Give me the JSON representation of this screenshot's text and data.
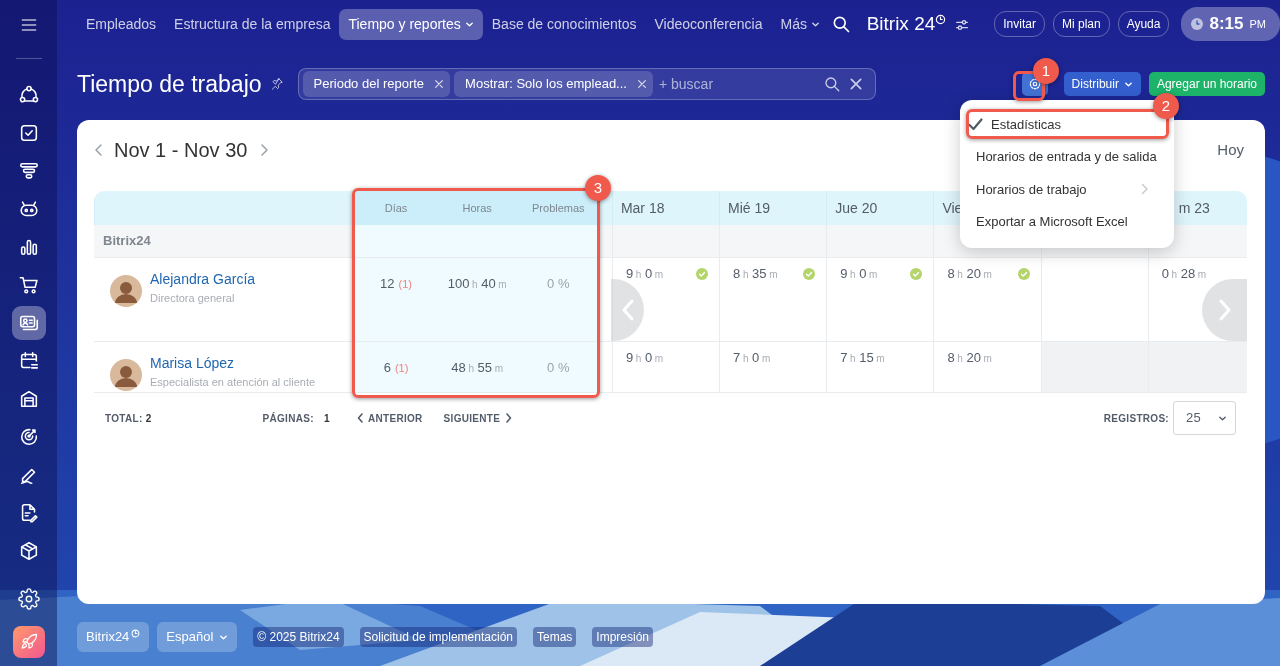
{
  "sidebar": {
    "items": [
      {
        "selected": false
      },
      {
        "selected": false
      },
      {
        "selected": false
      },
      {
        "selected": false
      },
      {
        "selected": false
      },
      {
        "selected": false
      },
      {
        "selected": true
      },
      {
        "selected": false
      },
      {
        "selected": false
      },
      {
        "selected": false
      },
      {
        "selected": false
      },
      {
        "selected": false
      },
      {
        "selected": false
      }
    ]
  },
  "top_nav": {
    "tabs": [
      {
        "label": "Empleados",
        "selected": false,
        "has_menu": false
      },
      {
        "label": "Estructura de la empresa",
        "selected": false,
        "has_menu": false
      },
      {
        "label": "Tiempo y reportes",
        "selected": true,
        "has_menu": true
      },
      {
        "label": "Base de conocimientos",
        "selected": false,
        "has_menu": false
      },
      {
        "label": "Videoconferencia",
        "selected": false,
        "has_menu": false
      },
      {
        "label": "Más",
        "selected": false,
        "has_menu": true
      }
    ]
  },
  "header_right": {
    "logo": "Bitrix 24",
    "buttons": [
      "Invitar",
      "Mi plan",
      "Ayuda"
    ],
    "clock": {
      "time": "8:15",
      "period": "PM"
    }
  },
  "toolbar": {
    "title": "Tiempo de trabajo",
    "filters": [
      "Periodo del reporte",
      "Mostrar: Solo los emplead..."
    ],
    "search_placeholder": "+ buscar",
    "buttons": [
      {
        "label": "Distribuir",
        "kind": "dropdown"
      },
      {
        "label": "Agregar un horario",
        "kind": "primary"
      }
    ]
  },
  "period": {
    "label": "Nov 1 - Nov 30",
    "today": "Hoy"
  },
  "table": {
    "stats_columns": [
      "Días",
      "Horas",
      "Problemas"
    ],
    "day_columns": [
      {
        "label": "Mar 18"
      },
      {
        "label": "Mié 19"
      },
      {
        "label": "Jue 20"
      },
      {
        "label": "Vie"
      },
      {},
      {
        "label": "m 23"
      }
    ],
    "group": "Bitrix24",
    "rows": [
      {
        "name": "Alejandra García",
        "position": "Directora general",
        "days": "12",
        "issues": "(1)",
        "hours": "100 h 40 m",
        "problems": "0 %",
        "cells": [
          {
            "time": "9 h 0 m",
            "confirmed": true,
            "day_off": false
          },
          {
            "time": "8 h 35 m",
            "confirmed": true,
            "day_off": false
          },
          {
            "time": "9 h 0 m",
            "confirmed": true,
            "day_off": false
          },
          {
            "time": "8 h 20 m",
            "confirmed": true,
            "day_off": false
          },
          {
            "confirmed": false,
            "day_off": false
          },
          {
            "time": "0 h 28 m",
            "confirmed": false,
            "day_off": false
          }
        ]
      },
      {
        "name": "Marisa López",
        "position": "Especialista en atención al cliente",
        "days": "6",
        "issues": "(1)",
        "hours": "48 h 55 m",
        "problems": "0 %",
        "cells": [
          {
            "time": "9 h 0 m",
            "confirmed": false,
            "day_off": false
          },
          {
            "time": "7 h 0 m",
            "confirmed": false,
            "day_off": false
          },
          {
            "time": "7 h 15 m",
            "confirmed": false,
            "day_off": false
          },
          {
            "time": "8 h 20 m",
            "confirmed": false,
            "day_off": false
          },
          {
            "confirmed": false,
            "day_off": true
          },
          {
            "confirmed": false,
            "day_off": true
          }
        ]
      }
    ]
  },
  "pager": {
    "total_label": "TOTAL:",
    "total": "2",
    "pages_label": "PÁGINAS:",
    "pages": "1",
    "prev": "ANTERIOR",
    "next": "SIGUIENTE",
    "per_page_label": "REGISTROS:",
    "per_page": "25"
  },
  "settings_menu": {
    "items": [
      {
        "label": "Estadísticas",
        "checked": true,
        "has_submenu": false
      },
      {
        "label": "Horarios de entrada y de salida",
        "checked": false,
        "has_submenu": false
      },
      {
        "label": "Horarios de trabajo",
        "checked": false,
        "has_submenu": true
      },
      {
        "label": "Exportar a Microsoft Excel",
        "checked": false,
        "has_submenu": false
      }
    ]
  },
  "annotations": [
    {
      "label": "1"
    },
    {
      "label": "2"
    },
    {
      "label": "3"
    }
  ],
  "footer": {
    "brand": "Bitrix24",
    "language": "Español",
    "copyright": "© 2025 Bitrix24",
    "links": [
      "Solicitud de implementación",
      "Temas",
      "Impresión"
    ]
  }
}
